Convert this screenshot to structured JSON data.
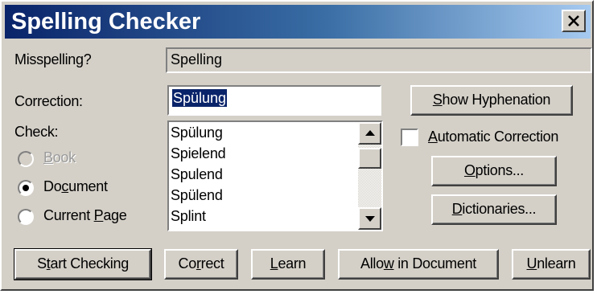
{
  "window": {
    "title": "Spelling Checker",
    "close_icon": "close-icon"
  },
  "fields": {
    "misspelling_label": "Misspelling?",
    "misspelling_value": "Spelling",
    "correction_label": "Correction:",
    "correction_value": "Spülung"
  },
  "check": {
    "label": "Check:",
    "options": [
      {
        "label": "Book",
        "accel": "B",
        "enabled": false,
        "selected": false
      },
      {
        "label": "Document",
        "accel": "c",
        "enabled": true,
        "selected": true
      },
      {
        "label": "Current Page",
        "accel": "P",
        "enabled": true,
        "selected": false
      }
    ]
  },
  "suggestions": {
    "items": [
      "Spülung",
      "Spielend",
      "Spulend",
      "Spülend",
      "Splint"
    ]
  },
  "options": {
    "show_hyphenation_label": "Show Hyphenation",
    "automatic_correction_label": "Automatic Correction",
    "automatic_correction_checked": false,
    "options_label": "Options...",
    "dictionaries_label": "Dictionaries..."
  },
  "actions": {
    "start_checking": "Start Checking",
    "correct": "Correct",
    "learn": "Learn",
    "allow_in_document": "Allow in Document",
    "unlearn": "Unlearn"
  },
  "colors": {
    "face": "#d4d0c8",
    "title_start": "#0a246a",
    "title_end": "#a6caf0",
    "selection": "#0a246a"
  }
}
